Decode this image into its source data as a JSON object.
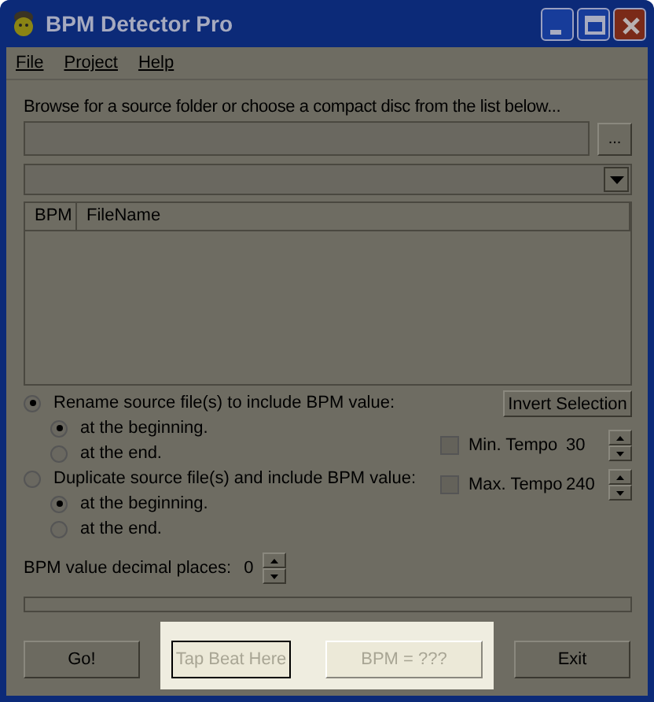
{
  "window": {
    "title": "BPM Detector Pro"
  },
  "menu": [
    {
      "label": "File"
    },
    {
      "label": "Project"
    },
    {
      "label": "Help"
    }
  ],
  "source": {
    "prompt": "Browse for a source folder or choose a compact disc from the list below...",
    "browse_button": "..."
  },
  "file_list": {
    "columns": [
      "BPM",
      "FileName"
    ]
  },
  "options": [
    {
      "label": "Rename source file(s) to include BPM value:",
      "selected": true,
      "children": [
        {
          "label": "at the beginning.",
          "selected": true
        },
        {
          "label": "at the end.",
          "selected": false
        }
      ]
    },
    {
      "label": "Duplicate source file(s) and include BPM value:",
      "selected": false,
      "children": [
        {
          "label": "at the beginning.",
          "selected": true
        },
        {
          "label": "at the end.",
          "selected": false
        }
      ]
    }
  ],
  "invert_button": "Invert Selection",
  "tempo": [
    {
      "label": "Min. Tempo",
      "value": "30",
      "checked": false
    },
    {
      "label": "Max. Tempo",
      "value": "240",
      "checked": false
    }
  ],
  "decimal": {
    "label": "BPM value decimal places:",
    "value": "0"
  },
  "buttons": [
    {
      "label": "Go!",
      "disabled": false,
      "focused": false,
      "highlighted": false
    },
    {
      "label": "Tap Beat Here",
      "disabled": true,
      "focused": true,
      "highlighted": true
    },
    {
      "label": "BPM = ???",
      "disabled": true,
      "focused": false,
      "highlighted": true
    },
    {
      "label": "Exit",
      "disabled": false,
      "focused": false,
      "highlighted": false
    }
  ]
}
